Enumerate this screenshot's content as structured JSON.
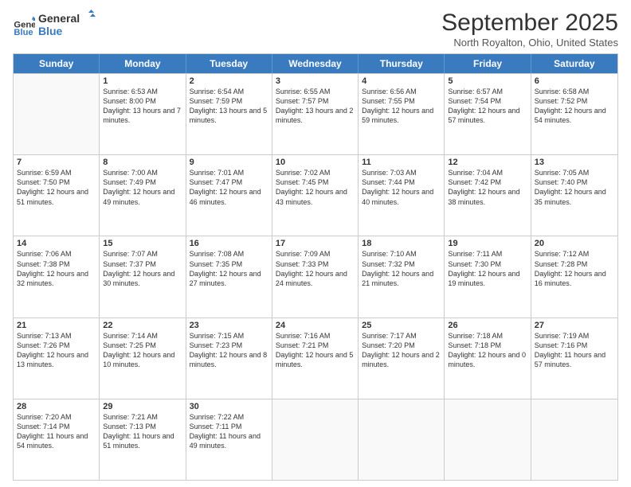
{
  "header": {
    "logo_line1": "General",
    "logo_line2": "Blue",
    "month_title": "September 2025",
    "location": "North Royalton, Ohio, United States"
  },
  "days_of_week": [
    "Sunday",
    "Monday",
    "Tuesday",
    "Wednesday",
    "Thursday",
    "Friday",
    "Saturday"
  ],
  "weeks": [
    [
      {
        "day": "",
        "empty": true
      },
      {
        "day": "1",
        "sunrise": "6:53 AM",
        "sunset": "8:00 PM",
        "daylight": "13 hours and 7 minutes."
      },
      {
        "day": "2",
        "sunrise": "6:54 AM",
        "sunset": "7:59 PM",
        "daylight": "13 hours and 5 minutes."
      },
      {
        "day": "3",
        "sunrise": "6:55 AM",
        "sunset": "7:57 PM",
        "daylight": "13 hours and 2 minutes."
      },
      {
        "day": "4",
        "sunrise": "6:56 AM",
        "sunset": "7:55 PM",
        "daylight": "12 hours and 59 minutes."
      },
      {
        "day": "5",
        "sunrise": "6:57 AM",
        "sunset": "7:54 PM",
        "daylight": "12 hours and 57 minutes."
      },
      {
        "day": "6",
        "sunrise": "6:58 AM",
        "sunset": "7:52 PM",
        "daylight": "12 hours and 54 minutes."
      }
    ],
    [
      {
        "day": "7",
        "sunrise": "6:59 AM",
        "sunset": "7:50 PM",
        "daylight": "12 hours and 51 minutes."
      },
      {
        "day": "8",
        "sunrise": "7:00 AM",
        "sunset": "7:49 PM",
        "daylight": "12 hours and 49 minutes."
      },
      {
        "day": "9",
        "sunrise": "7:01 AM",
        "sunset": "7:47 PM",
        "daylight": "12 hours and 46 minutes."
      },
      {
        "day": "10",
        "sunrise": "7:02 AM",
        "sunset": "7:45 PM",
        "daylight": "12 hours and 43 minutes."
      },
      {
        "day": "11",
        "sunrise": "7:03 AM",
        "sunset": "7:44 PM",
        "daylight": "12 hours and 40 minutes."
      },
      {
        "day": "12",
        "sunrise": "7:04 AM",
        "sunset": "7:42 PM",
        "daylight": "12 hours and 38 minutes."
      },
      {
        "day": "13",
        "sunrise": "7:05 AM",
        "sunset": "7:40 PM",
        "daylight": "12 hours and 35 minutes."
      }
    ],
    [
      {
        "day": "14",
        "sunrise": "7:06 AM",
        "sunset": "7:38 PM",
        "daylight": "12 hours and 32 minutes."
      },
      {
        "day": "15",
        "sunrise": "7:07 AM",
        "sunset": "7:37 PM",
        "daylight": "12 hours and 30 minutes."
      },
      {
        "day": "16",
        "sunrise": "7:08 AM",
        "sunset": "7:35 PM",
        "daylight": "12 hours and 27 minutes."
      },
      {
        "day": "17",
        "sunrise": "7:09 AM",
        "sunset": "7:33 PM",
        "daylight": "12 hours and 24 minutes."
      },
      {
        "day": "18",
        "sunrise": "7:10 AM",
        "sunset": "7:32 PM",
        "daylight": "12 hours and 21 minutes."
      },
      {
        "day": "19",
        "sunrise": "7:11 AM",
        "sunset": "7:30 PM",
        "daylight": "12 hours and 19 minutes."
      },
      {
        "day": "20",
        "sunrise": "7:12 AM",
        "sunset": "7:28 PM",
        "daylight": "12 hours and 16 minutes."
      }
    ],
    [
      {
        "day": "21",
        "sunrise": "7:13 AM",
        "sunset": "7:26 PM",
        "daylight": "12 hours and 13 minutes."
      },
      {
        "day": "22",
        "sunrise": "7:14 AM",
        "sunset": "7:25 PM",
        "daylight": "12 hours and 10 minutes."
      },
      {
        "day": "23",
        "sunrise": "7:15 AM",
        "sunset": "7:23 PM",
        "daylight": "12 hours and 8 minutes."
      },
      {
        "day": "24",
        "sunrise": "7:16 AM",
        "sunset": "7:21 PM",
        "daylight": "12 hours and 5 minutes."
      },
      {
        "day": "25",
        "sunrise": "7:17 AM",
        "sunset": "7:20 PM",
        "daylight": "12 hours and 2 minutes."
      },
      {
        "day": "26",
        "sunrise": "7:18 AM",
        "sunset": "7:18 PM",
        "daylight": "12 hours and 0 minutes."
      },
      {
        "day": "27",
        "sunrise": "7:19 AM",
        "sunset": "7:16 PM",
        "daylight": "11 hours and 57 minutes."
      }
    ],
    [
      {
        "day": "28",
        "sunrise": "7:20 AM",
        "sunset": "7:14 PM",
        "daylight": "11 hours and 54 minutes."
      },
      {
        "day": "29",
        "sunrise": "7:21 AM",
        "sunset": "7:13 PM",
        "daylight": "11 hours and 51 minutes."
      },
      {
        "day": "30",
        "sunrise": "7:22 AM",
        "sunset": "7:11 PM",
        "daylight": "11 hours and 49 minutes."
      },
      {
        "day": "",
        "empty": true
      },
      {
        "day": "",
        "empty": true
      },
      {
        "day": "",
        "empty": true
      },
      {
        "day": "",
        "empty": true
      }
    ]
  ]
}
